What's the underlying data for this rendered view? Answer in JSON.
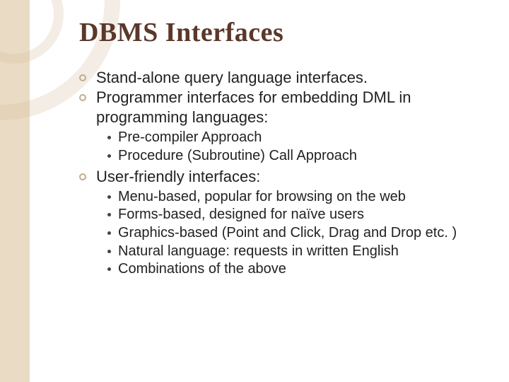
{
  "title": "DBMS Interfaces",
  "items": [
    {
      "text": "Stand-alone query language interfaces."
    },
    {
      "text": "Programmer interfaces for embedding DML in programming languages:",
      "children": [
        {
          "text": "Pre-compiler Approach"
        },
        {
          "text": "Procedure (Subroutine) Call Approach"
        }
      ]
    },
    {
      "text": "User-friendly interfaces:",
      "children": [
        {
          "text": "Menu-based, popular for browsing on the web"
        },
        {
          "text": "Forms-based, designed for naïve users"
        },
        {
          "text": "Graphics-based (Point and Click, Drag and Drop etc. )"
        },
        {
          "text": "Natural language: requests in written English"
        },
        {
          "text": "Combinations of the above"
        }
      ]
    }
  ]
}
